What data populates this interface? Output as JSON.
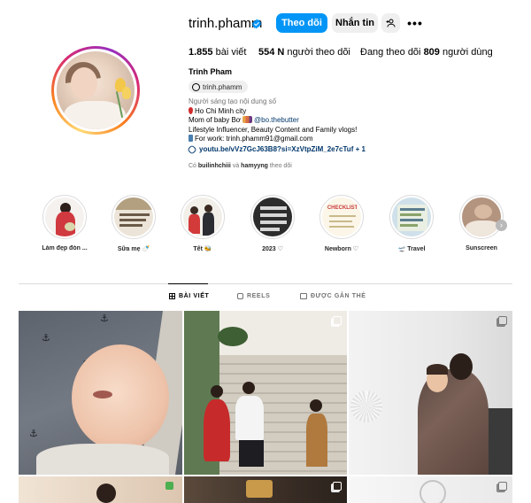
{
  "profile": {
    "username": "trinh.phamm",
    "follow_label": "Theo dõi",
    "message_label": "Nhắn tin",
    "more_label": "•••",
    "posts_count": "1.855",
    "posts_label": "bài viết",
    "followers_count": "554 N",
    "followers_label": "người theo dõi",
    "following_prefix": "Đang theo dõi",
    "following_count": "809",
    "following_label": "người dùng",
    "full_name": "Trinh Pham",
    "threads_handle": "trinh.phamm",
    "category": "Người sáng tạo nội dung số",
    "bio_line1": "Ho Chi Minh city",
    "bio_line2_prefix": "Mom of baby Bơ",
    "bio_mention": "@bo.thebutter",
    "bio_line3": "Lifestyle Influencer, Beauty Content and Family vlogs!",
    "bio_line4": "For work: trinh.phamm91@gmail.com",
    "link": "youtu.be/vVz7GcJ63B8?si=XzVtpZiM_2e7cTuf + 1",
    "followed_by_prefix": "Có",
    "followed_by_user1": "builinhchiii",
    "followed_by_and": "và",
    "followed_by_user2": "hamyyng",
    "followed_by_suffix": "theo dõi"
  },
  "highlights": [
    {
      "label": "Làm đẹp đón ..."
    },
    {
      "label": "Sữa mẹ 🍼"
    },
    {
      "label": "Tết 🐝"
    },
    {
      "label": "2023 ♡"
    },
    {
      "label": "Newborn ♡"
    },
    {
      "label": "🛫 Travel"
    },
    {
      "label": "Sunscreen"
    }
  ],
  "highlight_texts": {
    "checklist": "CHECKLIST"
  },
  "tabs": {
    "posts": "BÀI VIẾT",
    "reels": "REELS",
    "tagged": "ĐƯỢC GẮN THẺ"
  },
  "colors": {
    "primary_button": "#0095f6",
    "link": "#00376b",
    "verified": "#0095f6"
  }
}
